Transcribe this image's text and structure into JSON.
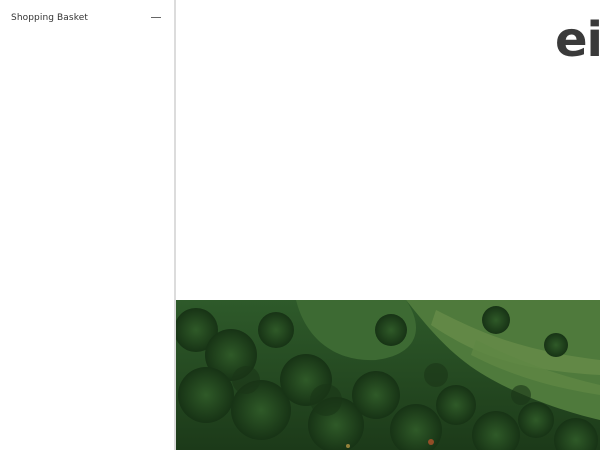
{
  "basket_panel": {
    "title": "Shopping Basket",
    "collapse_icon": "minus-icon"
  },
  "brand": {
    "logo_text": "ei"
  },
  "hero": {
    "description_icon": "landscape-photo",
    "colors": {
      "canopy_dark": "#1f3d1c",
      "canopy_mid": "#2f5a28",
      "canopy_light": "#4f7a3c",
      "field_green": "#6b8f4a"
    }
  },
  "colors": {
    "panel_border": "#dcdcdc",
    "text": "#333333",
    "logo": "#3a3a3a"
  }
}
